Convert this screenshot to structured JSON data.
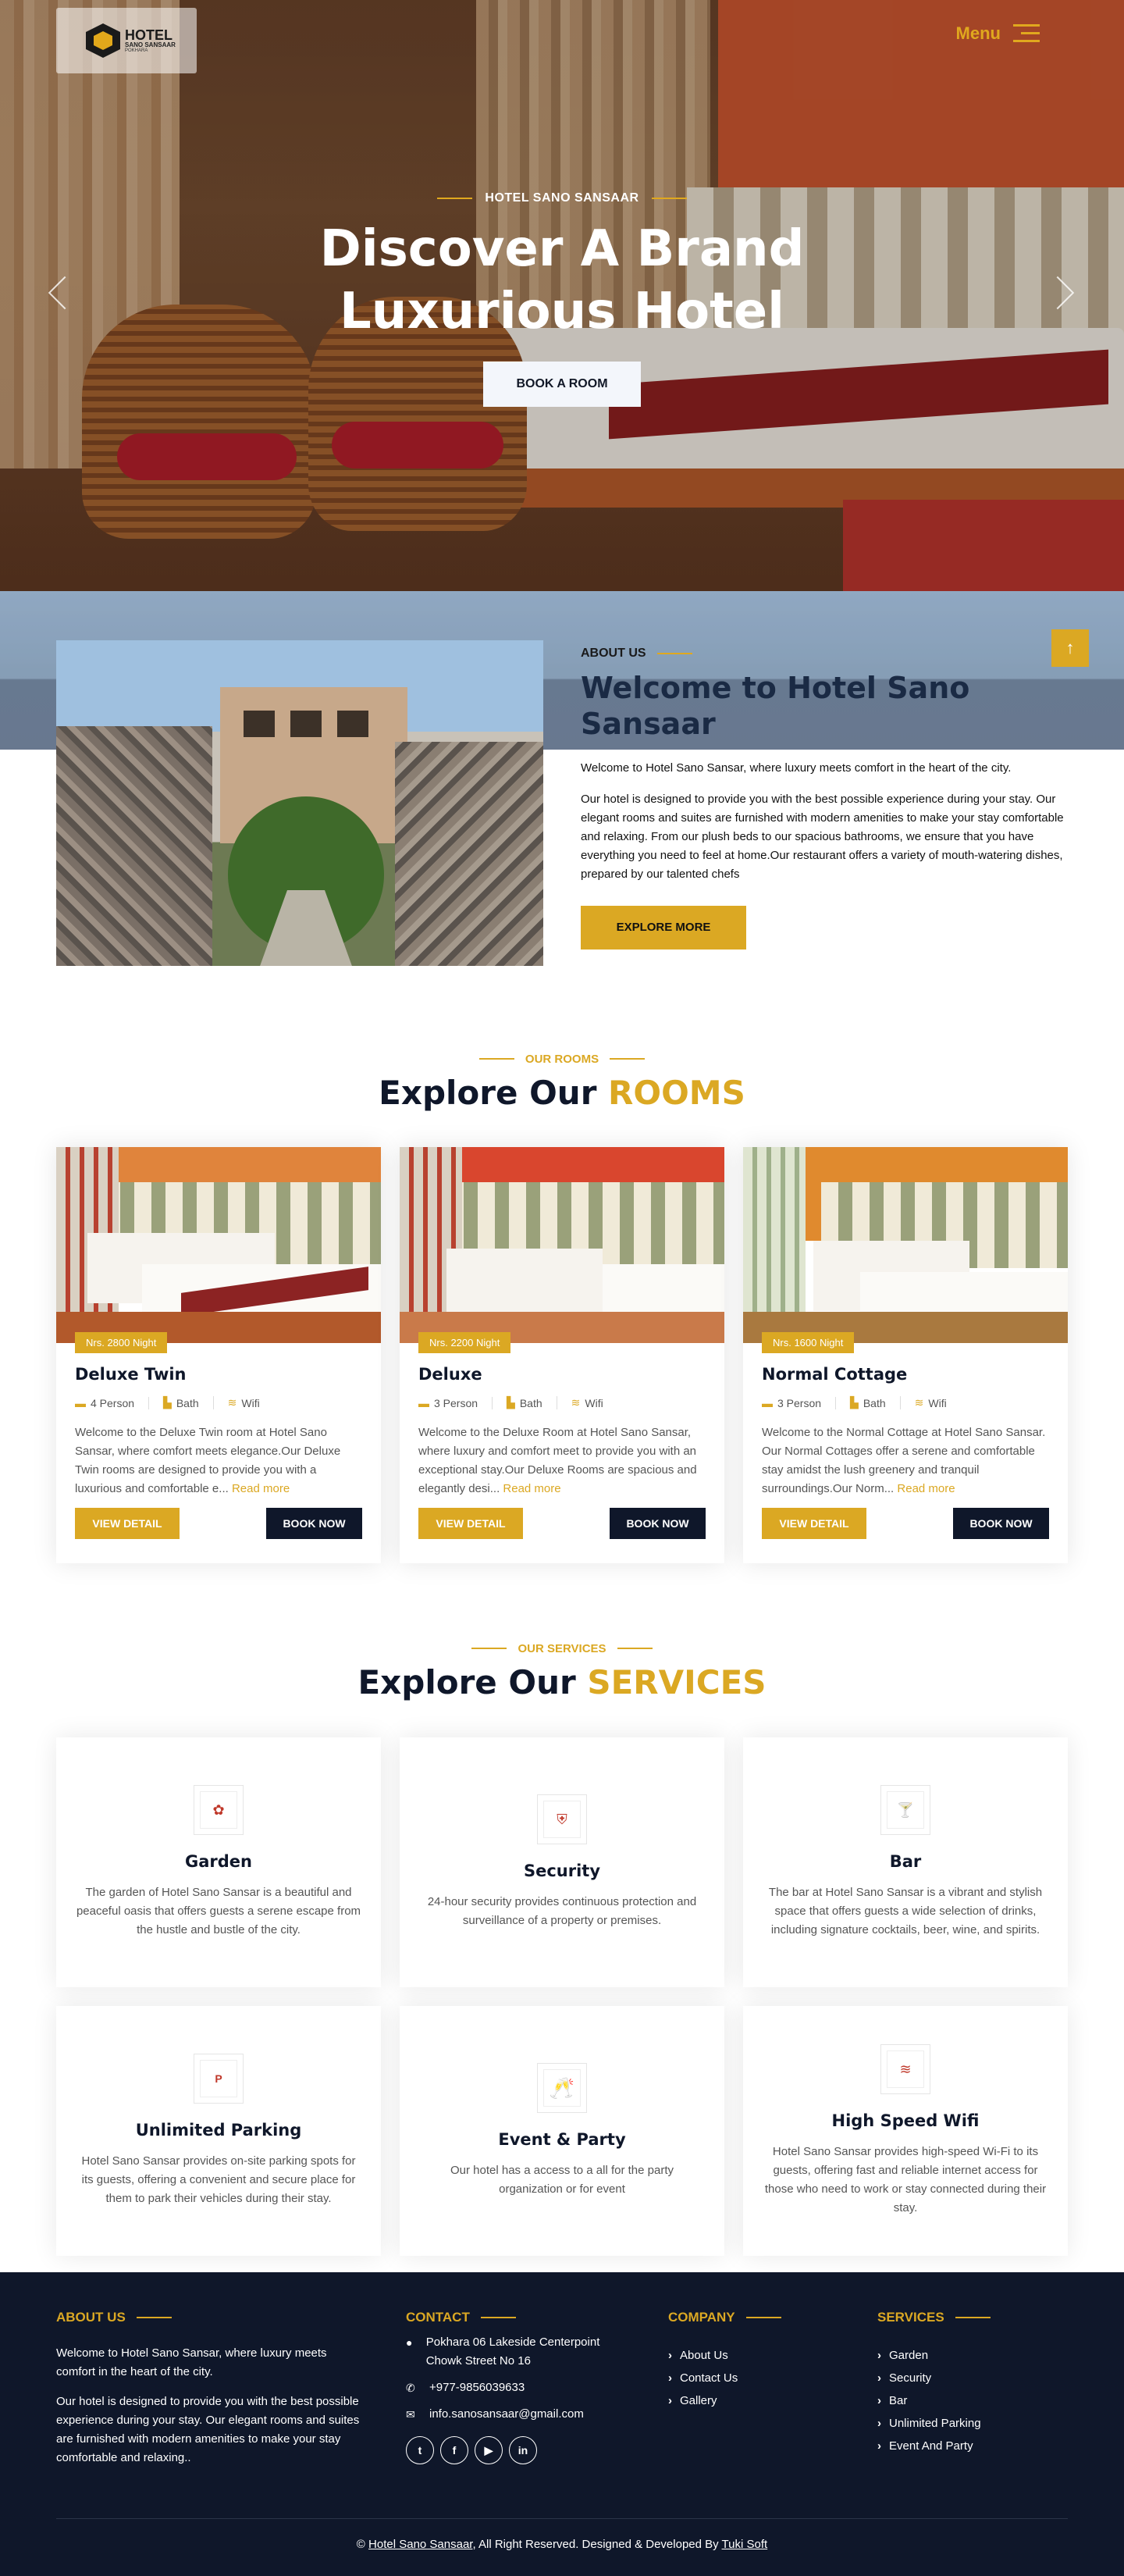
{
  "header": {
    "logo_main": "HOTEL",
    "logo_sub": "SANO SANSAAR",
    "logo_tag": "POKHARA",
    "menu_label": "Menu"
  },
  "hero": {
    "eyebrow": "HOTEL SANO SANSAAR",
    "title_line1": "Discover A Brand",
    "title_line2": "Luxurious Hotel",
    "button": "BOOK A ROOM"
  },
  "about": {
    "eyebrow": "ABOUT US",
    "title": "Welcome to Hotel Sano Sansaar",
    "p1": "Welcome to Hotel Sano Sansar, where luxury meets comfort in the heart of the city.",
    "p2": "Our hotel is designed to provide you with the best possible experience during your stay. Our elegant rooms and suites are furnished with modern amenities to make your stay comfortable and relaxing. From our plush beds to our spacious bathrooms, we ensure that you have everything you need to feel at home.Our restaurant offers a variety of mouth-watering dishes, prepared by our talented chefs",
    "button": "EXPLORE MORE",
    "to_top": "↑"
  },
  "rooms_section": {
    "eyebrow": "OUR ROOMS",
    "title_pre": "Explore Our ",
    "title_accent": "ROOMS"
  },
  "rooms": [
    {
      "price": "Nrs. 2800 Night",
      "name": "Deluxe Twin",
      "persons": "4 Person",
      "bath": "Bath",
      "wifi": "Wifi",
      "desc": "Welcome to the Deluxe Twin room at Hotel Sano Sansar, where comfort meets elegance.Our Deluxe Twin rooms are designed to provide you with a luxurious and comfortable e...",
      "more": "Read more",
      "detail_btn": "VIEW DETAIL",
      "book_btn": "BOOK NOW"
    },
    {
      "price": "Nrs. 2200 Night",
      "name": "Deluxe",
      "persons": "3 Person",
      "bath": "Bath",
      "wifi": "Wifi",
      "desc": "Welcome to the Deluxe Room at Hotel Sano Sansar, where luxury and comfort meet to provide you with an exceptional stay.Our Deluxe Rooms are spacious and elegantly desi...",
      "more": "Read more",
      "detail_btn": "VIEW DETAIL",
      "book_btn": "BOOK NOW"
    },
    {
      "price": "Nrs. 1600 Night",
      "name": "Normal Cottage",
      "persons": "3 Person",
      "bath": "Bath",
      "wifi": "Wifi",
      "desc": "Welcome to the Normal Cottage at Hotel Sano Sansar. Our Normal Cottages offer a serene and comfortable stay amidst the lush greenery and tranquil surroundings.Our Norm...",
      "more": "Read more",
      "detail_btn": "VIEW DETAIL",
      "book_btn": "BOOK NOW"
    }
  ],
  "services_section": {
    "eyebrow": "OUR SERVICES",
    "title_pre": "Explore Our ",
    "title_accent": "SERVICES"
  },
  "services": [
    {
      "icon": "garden-icon",
      "glyph": "✿",
      "title": "Garden",
      "desc": "The garden of Hotel Sano Sansar is a beautiful and peaceful oasis that offers guests a serene escape from the hustle and bustle of the city."
    },
    {
      "icon": "shield-icon",
      "glyph": "⛨",
      "title": "Security",
      "desc": "24-hour security provides continuous protection and surveillance of a property or premises."
    },
    {
      "icon": "cocktail-icon",
      "glyph": "🍸",
      "title": "Bar",
      "desc": "The bar at Hotel Sano Sansar is a vibrant and stylish space that offers guests a wide selection of drinks, including signature cocktails, beer, wine, and spirits."
    },
    {
      "icon": "parking-icon",
      "glyph": "P",
      "title": "Unlimited Parking",
      "desc": "Hotel Sano Sansar provides on-site parking spots for its guests, offering a convenient and secure place for them to park their vehicles during their stay."
    },
    {
      "icon": "cheers-icon",
      "glyph": "🥂",
      "title": "Event & Party",
      "desc": "Our hotel has a access to a all for the party organization or for event"
    },
    {
      "icon": "wifi-icon",
      "glyph": "≋",
      "title": "High Speed Wifi",
      "desc": "Hotel Sano Sansar provides high-speed Wi-Fi to its guests, offering fast and reliable internet access for those who need to work or stay connected during their stay."
    }
  ],
  "footer": {
    "about_head": "ABOUT US",
    "about_p1": "Welcome to Hotel Sano Sansar, where luxury meets comfort in the heart of the city.",
    "about_p2": "Our hotel is designed to provide you with the best possible experience during your stay. Our elegant rooms and suites are furnished with modern amenities to make your stay comfortable and relaxing..",
    "contact_head": "CONTACT",
    "address": "Pokhara 06 Lakeside Centerpoint Chowk Street No 16",
    "phone": "+977-9856039633",
    "email": "info.sanosansaar@gmail.com",
    "company_head": "COMPANY",
    "company_links": [
      "About Us",
      "Contact Us",
      "Gallery"
    ],
    "services_head": "SERVICES",
    "service_links": [
      "Garden",
      "Security",
      "Bar",
      "Unlimited Parking",
      "Event And Party"
    ],
    "copy_pre": "© ",
    "copy_brand": "Hotel Sano Sansaar",
    "copy_mid": ", All Right Reserved. Designed & Developed By ",
    "copy_dev": "Tuki Soft"
  }
}
